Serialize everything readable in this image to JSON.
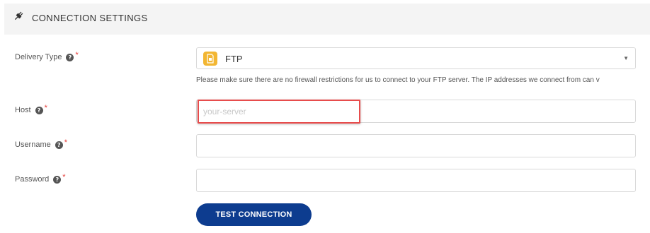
{
  "section": {
    "title": "CONNECTION SETTINGS",
    "icon": "plug-icon"
  },
  "delivery_type": {
    "label": "Delivery Type",
    "required_mark": "*",
    "help_mark": "?",
    "selected": "FTP",
    "selected_icon": "ftp-icon",
    "arrow": "▼",
    "hint": "Please make sure there are no firewall restrictions for us to connect to your FTP server. The IP addresses we connect from can v"
  },
  "host": {
    "label": "Host",
    "required_mark": "*",
    "help_mark": "?",
    "value": "",
    "placeholder": "your-server"
  },
  "username": {
    "label": "Username",
    "required_mark": "*",
    "help_mark": "?",
    "value": "",
    "placeholder": ""
  },
  "password": {
    "label": "Password",
    "required_mark": "*",
    "help_mark": "?",
    "value": "",
    "placeholder": ""
  },
  "actions": {
    "test_label": "TEST CONNECTION"
  },
  "colors": {
    "accent_button": "#0d3c8f",
    "required": "#e53935",
    "highlight": "#e74c4c",
    "ftp_badge": "#f2b632"
  }
}
